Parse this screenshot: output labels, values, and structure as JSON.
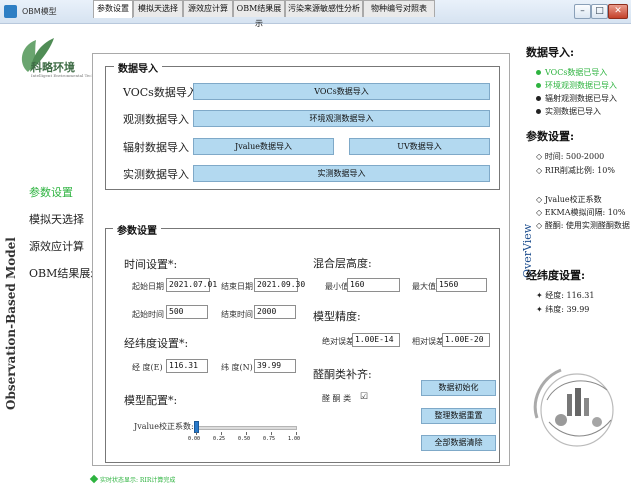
{
  "window": {
    "title": "OBM模型",
    "min": "–",
    "max": "□",
    "close": "✕"
  },
  "logo": {
    "name": "科略环境",
    "sub": "Intelligent Environmental Tech"
  },
  "vertical_title": "Observation-Based Model",
  "overview_title": "OverView",
  "nav": [
    "参数设置",
    "模拟天选择",
    "源效应计算",
    "OBM结果展示"
  ],
  "tabs": [
    "参数设置",
    "模拟天选择",
    "源效应计算",
    "OBM结果展示",
    "污染来源敏感性分析",
    "物种编号对照表"
  ],
  "data_import": {
    "title": "数据导入",
    "rows": [
      {
        "label": "VOCs数据导入",
        "button": "VOCs数据导入"
      },
      {
        "label": "观测数据导入",
        "button": "环境观测数据导入"
      },
      {
        "label": "辐射数据导入",
        "button": "Jvalue数据导入",
        "button2": "UV数据导入"
      },
      {
        "label": "实测数据导入",
        "button": "实测数据导入"
      }
    ]
  },
  "params": {
    "title": "参数设置",
    "time": {
      "label": "时间设置*:",
      "start_date_label": "起始日期",
      "start_date": "2021.07.01",
      "end_date_label": "结束日期",
      "end_date": "2021.09.30",
      "start_time_label": "起始时间",
      "start_time": "500",
      "end_time_label": "结束时间",
      "end_time": "2000"
    },
    "latlon": {
      "label": "经纬度设置*:",
      "lon_label": "经 度(E)",
      "lon": "116.31",
      "lat_label": "纬 度(N)",
      "lat": "39.99"
    },
    "model": {
      "label": "模型配置*:",
      "slider_label": "Jvalue校正系数:",
      "ticks": [
        "0.00",
        "0.25",
        "0.50",
        "0.75",
        "1.00"
      ],
      "slider_value": 0
    },
    "mixing": {
      "label": "混合层高度:",
      "min_label": "最小值",
      "min": "160",
      "max_label": "最大值",
      "max": "1560"
    },
    "precision": {
      "label": "模型精度:",
      "abs_label": "绝对误差",
      "abs": "1.00E-14",
      "rel_label": "相对误差",
      "rel": "1.00E-20"
    },
    "ketone": {
      "label": "醛酮类补齐:",
      "check_label": "醛 酮 类",
      "check": "☑"
    },
    "buttons": [
      "数据初始化",
      "整理数据重置",
      "全部数据清除"
    ]
  },
  "overview": {
    "data_head": "数据导入:",
    "data_items": [
      {
        "text": "VOCs数据已导入",
        "ok": true
      },
      {
        "text": "环境观测数据已导入",
        "ok": true
      },
      {
        "text": "辐射观测数据已导入",
        "ok": false
      },
      {
        "text": "实测数据已导入",
        "ok": false
      }
    ],
    "param_head": "参数设置:",
    "param_items": [
      "◇ 时间: 500-2000",
      "◇ RIR削减比例: 10%",
      "◇ Jvalue校正系数",
      "◇ EKMA模拟间隔: 10%",
      "◇ 醛酮: 使用实测醛酮数据"
    ],
    "latlon_head": "经纬度设置:",
    "latlon_items": [
      "✦ 经度: 116.31",
      "✦ 纬度: 39.99"
    ]
  },
  "footer": "实时状态显示: RIR计算完成",
  "colors": {
    "accent_green": "#2db33f",
    "button_blue": "#b3d9f0"
  }
}
